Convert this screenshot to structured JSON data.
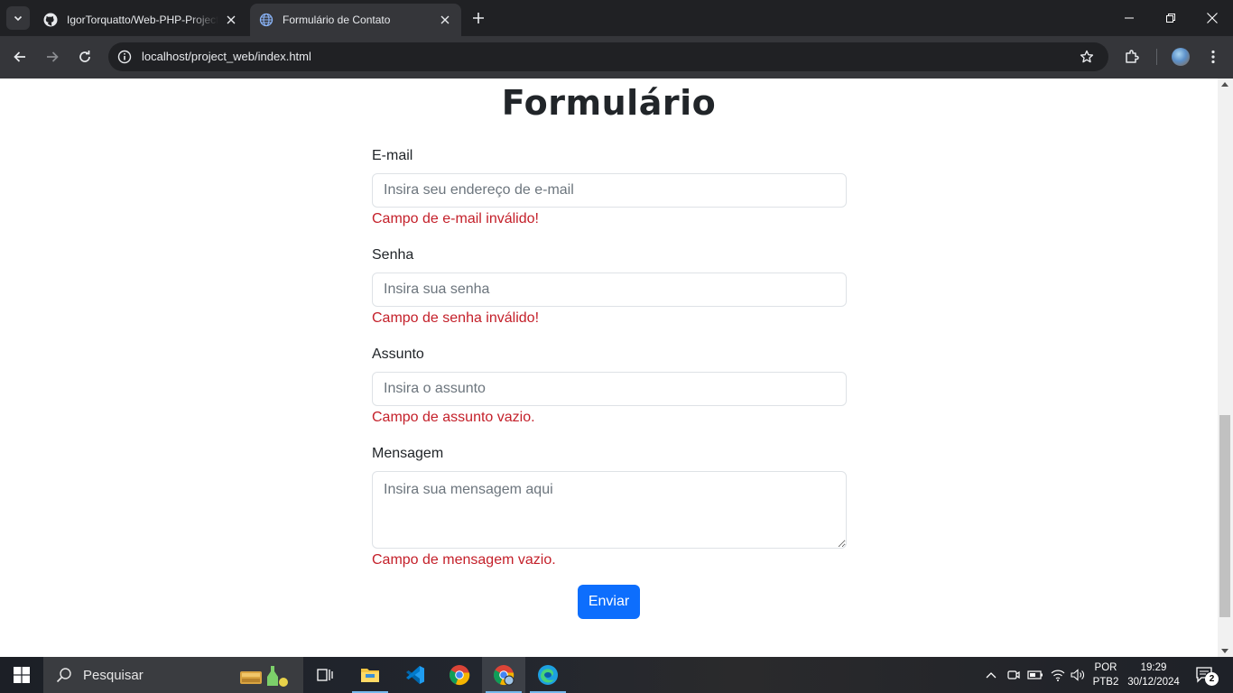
{
  "browser": {
    "tabs": [
      {
        "title": "IgorTorquatto/Web-PHP-Project",
        "active": false,
        "favicon": "github-icon"
      },
      {
        "title": "Formulário de Contato",
        "active": true,
        "favicon": "globe-icon"
      }
    ],
    "url": "localhost/project_web/index.html"
  },
  "page": {
    "title": "Formulário",
    "fields": {
      "email": {
        "label": "E-mail",
        "placeholder": "Insira seu endereço de e-mail",
        "error": "Campo de e-mail inválido!"
      },
      "password": {
        "label": "Senha",
        "placeholder": "Insira sua senha",
        "error": "Campo de senha inválido!"
      },
      "subject": {
        "label": "Assunto",
        "placeholder": "Insira o assunto",
        "error": "Campo de assunto vazio."
      },
      "message": {
        "label": "Mensagem",
        "placeholder": "Insira sua mensagem aqui",
        "error": "Campo de mensagem vazio."
      }
    },
    "submit_label": "Enviar",
    "colors": {
      "error": "#c4202a",
      "primary": "#0d6efd"
    }
  },
  "taskbar": {
    "search_placeholder": "Pesquisar",
    "apps": [
      "widgets-icon",
      "task-view-icon",
      "file-explorer-icon",
      "vscode-icon",
      "chrome-icon",
      "chrome-profile-icon",
      "edge-icon"
    ],
    "language_line1": "POR",
    "language_line2": "PTB2",
    "time": "19:29",
    "date": "30/12/2024",
    "notification_count": "2"
  }
}
